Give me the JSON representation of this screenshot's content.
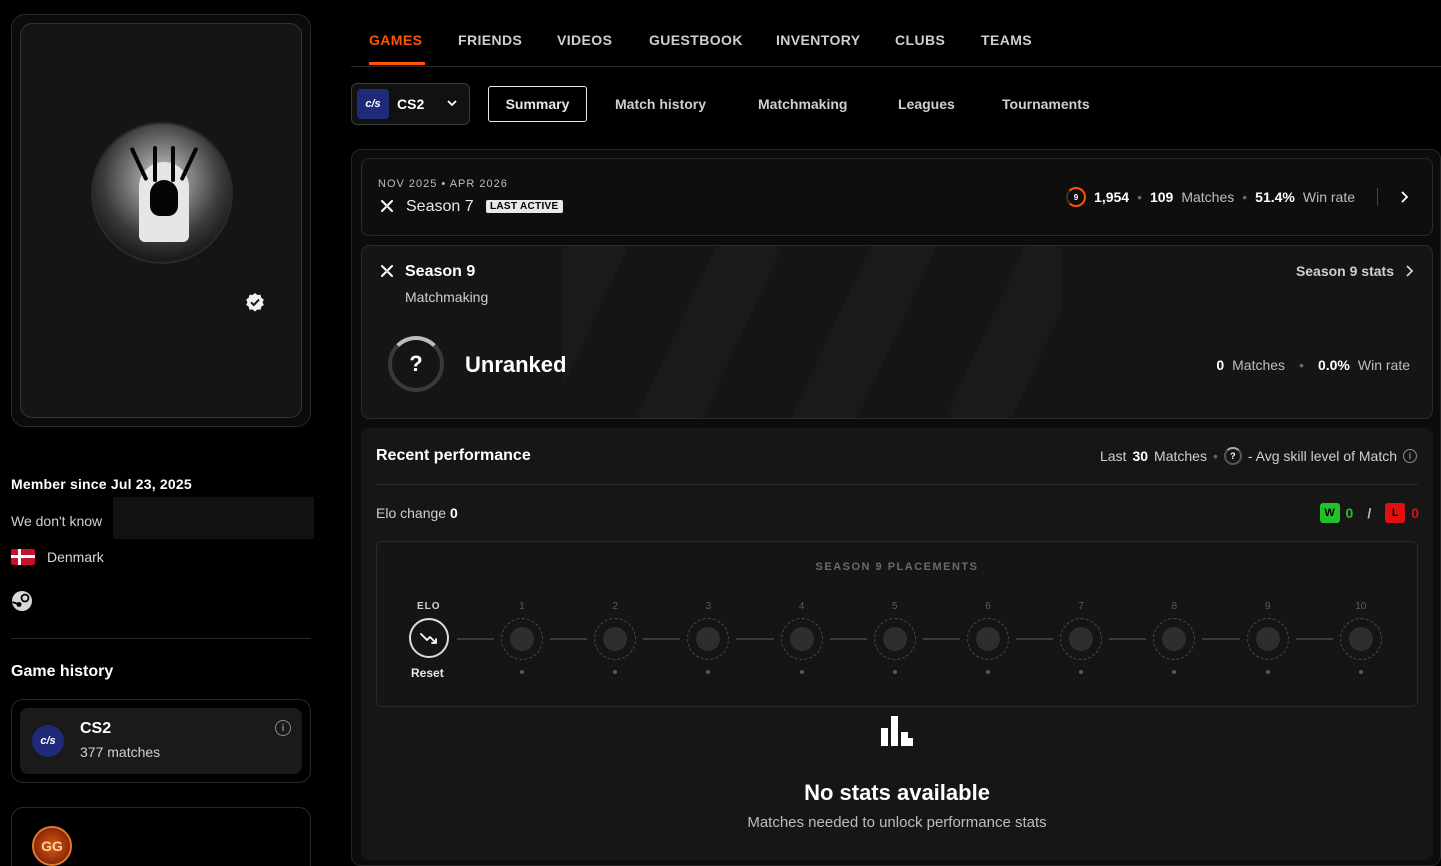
{
  "top_nav": {
    "tabs": [
      {
        "label": "GAMES",
        "active": true
      },
      {
        "label": "FRIENDS"
      },
      {
        "label": "VIDEOS"
      },
      {
        "label": "GUESTBOOK"
      },
      {
        "label": "INVENTORY"
      },
      {
        "label": "CLUBS"
      },
      {
        "label": "TEAMS"
      }
    ]
  },
  "game_select": {
    "logo": "c/s",
    "name": "CS2"
  },
  "sub_nav": {
    "tabs": [
      {
        "label": "Summary",
        "active": true
      },
      {
        "label": "Match history"
      },
      {
        "label": "Matchmaking"
      },
      {
        "label": "Leagues"
      },
      {
        "label": "Tournaments"
      }
    ]
  },
  "profile": {
    "member_since": "Member since Jul 23, 2025",
    "dont_know": "We don't know",
    "country": "Denmark"
  },
  "game_history": {
    "title": "Game history",
    "games": [
      {
        "logo": "c/s",
        "name": "CS2",
        "matches": "377 matches"
      }
    ],
    "badge": "GG"
  },
  "last_season": {
    "dates": "NOV 2025 • APR 2026",
    "name": "Season 7",
    "badge": "LAST ACTIVE",
    "skill_level": "9",
    "elo": "1,954",
    "matches_count": "109",
    "matches_label": "Matches",
    "win_rate": "51.4%",
    "win_rate_label": "Win rate"
  },
  "current_season": {
    "name": "Season 9",
    "mode": "Matchmaking",
    "stats_link": "Season 9 stats",
    "rank_symbol": "?",
    "rank": "Unranked",
    "matches_count": "0",
    "matches_label": "Matches",
    "win_rate": "0.0%",
    "win_rate_label": "Win rate"
  },
  "recent_performance": {
    "title": "Recent performance",
    "last_prefix": "Last",
    "last_count": "30",
    "last_suffix": "Matches",
    "avg_skill_symbol": "?",
    "avg_skill_label": "- Avg skill level of Match",
    "elo_change_label": "Elo change",
    "elo_change_value": "0",
    "wins_badge": "W",
    "wins": "0",
    "losses_badge": "L",
    "losses": "0",
    "placements_title": "SEASON 9 PLACEMENTS",
    "elo_label": "ELO",
    "reset_label": "Reset",
    "placement_numbers": [
      "1",
      "2",
      "3",
      "4",
      "5",
      "6",
      "7",
      "8",
      "9",
      "10"
    ],
    "no_stats_title": "No stats available",
    "no_stats_sub": "Matches needed to unlock performance stats"
  },
  "colors": {
    "accent": "#ff5500",
    "win": "#22c02a",
    "loss": "#e01010",
    "background": "#000000"
  }
}
